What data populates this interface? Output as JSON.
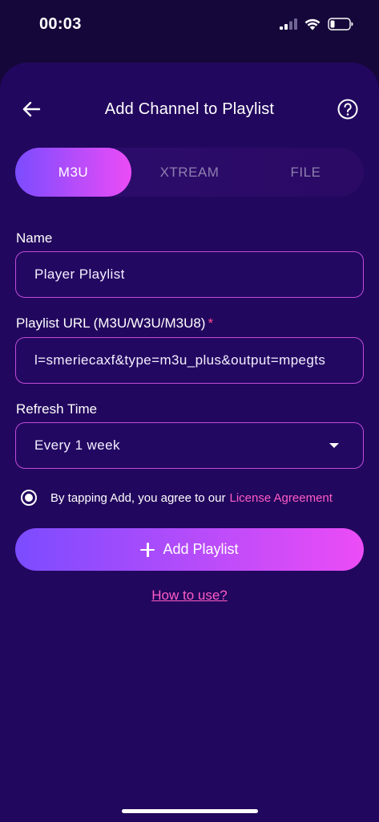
{
  "status_bar": {
    "time": "00:03"
  },
  "header": {
    "title": "Add Channel to Playlist",
    "back_icon": "arrow-left-icon",
    "help_icon": "help-circle-icon"
  },
  "tabs": [
    {
      "label": "M3U",
      "active": true
    },
    {
      "label": "XTREAM",
      "active": false
    },
    {
      "label": "FILE",
      "active": false
    }
  ],
  "form": {
    "name_label": "Name",
    "name_value": "Player Playlist",
    "url_label": "Playlist URL (M3U/W3U/M3U8)",
    "url_required_mark": "*",
    "url_value": "l=smeriecaxf&type=m3u_plus&output=mpegts",
    "refresh_label": "Refresh Time",
    "refresh_value": "Every 1 week"
  },
  "agreement": {
    "text": "By tapping Add, you agree to our",
    "link": "License Agreement",
    "checked": true
  },
  "actions": {
    "add_label": "Add Playlist",
    "how_label": "How to use?"
  },
  "colors": {
    "background": "#16073a",
    "sheet": "#22075e",
    "accent_start": "#7b4cff",
    "accent_end": "#ec4cf6",
    "link": "#ff5cc5"
  }
}
